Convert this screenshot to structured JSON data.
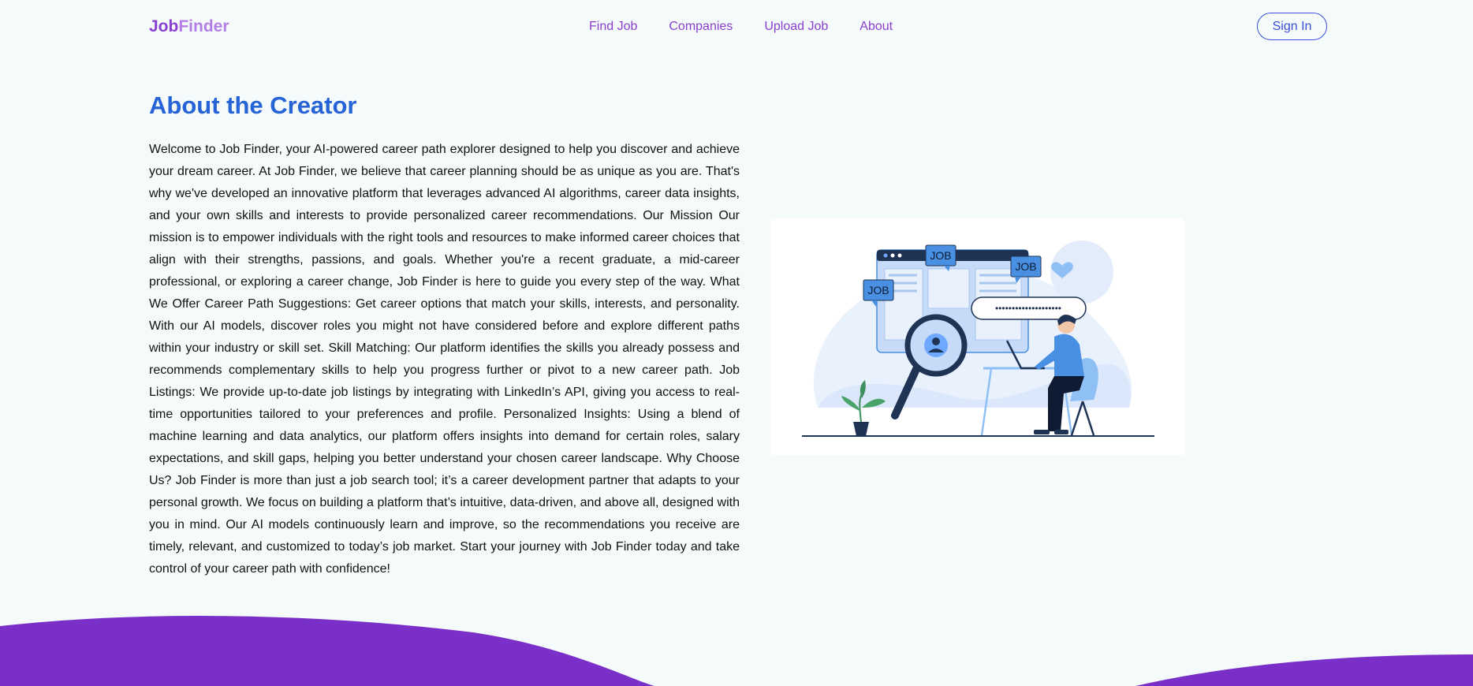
{
  "brand": {
    "part1": "Job",
    "part2": "Finder"
  },
  "nav": {
    "links": [
      "Find Job",
      "Companies",
      "Upload Job",
      "About"
    ],
    "signin": "Sign In"
  },
  "about": {
    "title": "About the Creator",
    "body": "Welcome to Job Finder, your AI-powered career path explorer designed to help you discover and achieve your dream career. At Job Finder, we believe that career planning should be as unique as you are. That's why we've developed an innovative platform that leverages advanced AI algorithms, career data insights, and your own skills and interests to provide personalized career recommendations. Our Mission Our mission is to empower individuals with the right tools and resources to make informed career choices that align with their strengths, passions, and goals. Whether you're a recent graduate, a mid-career professional, or exploring a career change, Job Finder is here to guide you every step of the way. What We Offer Career Path Suggestions: Get career options that match your skills, interests, and personality. With our AI models, discover roles you might not have considered before and explore different paths within your industry or skill set. Skill Matching: Our platform identifies the skills you already possess and recommends complementary skills to help you progress further or pivot to a new career path. Job Listings: We provide up-to-date job listings by integrating with LinkedIn’s API, giving you access to real-time opportunities tailored to your preferences and profile. Personalized Insights: Using a blend of machine learning and data analytics, our platform offers insights into demand for certain roles, salary expectations, and skill gaps, helping you better understand your chosen career landscape. Why Choose Us? Job Finder is more than just a job search tool; it’s a career development partner that adapts to your personal growth. We focus on building a platform that’s intuitive, data-driven, and above all, designed with you in mind. Our AI models continuously learn and improve, so the recommendations you receive are timely, relevant, and customized to today’s job market. Start your journey with Job Finder today and take control of your career path with confidence!"
  },
  "illustration": {
    "tags": [
      "JOB",
      "JOB",
      "JOB"
    ],
    "password_dots": "••••••••••••••••••••"
  },
  "colors": {
    "brand_purple": "#8a3fd0",
    "brand_light_purple": "#b57ee6",
    "heading_blue": "#2563d6",
    "wave_purple": "#7b2fc9",
    "background": "#f5fbfa"
  }
}
